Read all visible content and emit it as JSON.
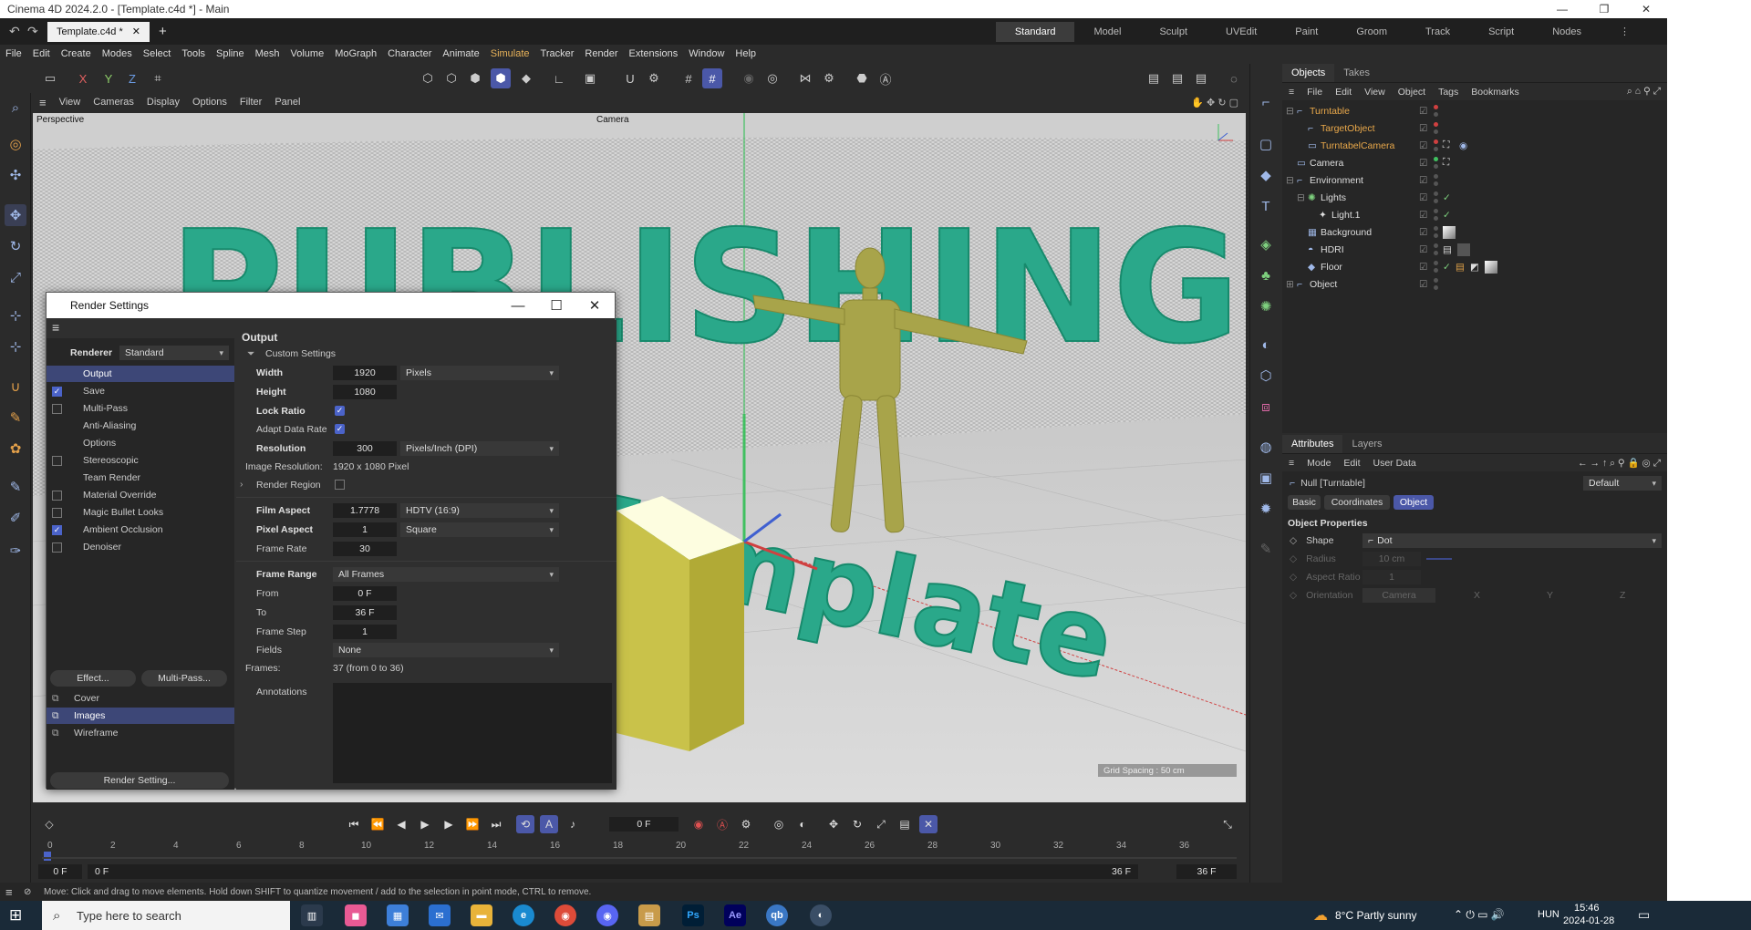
{
  "window": {
    "title": "Cinema 4D 2024.2.0 - [Template.c4d *] - Main",
    "minimize": "—",
    "maximize": "❐",
    "close": "✕"
  },
  "tabs": {
    "document": "Template.c4d *",
    "close": "✕",
    "add": "+"
  },
  "layouts": [
    "Standard",
    "Model",
    "Sculpt",
    "UVEdit",
    "Paint",
    "Groom",
    "Track",
    "Script",
    "Nodes"
  ],
  "menu": [
    "File",
    "Edit",
    "Create",
    "Modes",
    "Select",
    "Tools",
    "Spline",
    "Mesh",
    "Volume",
    "MoGraph",
    "Character",
    "Animate",
    "Simulate",
    "Tracker",
    "Render",
    "Extensions",
    "Window",
    "Help"
  ],
  "axis_buttons": [
    "X",
    "Y",
    "Z"
  ],
  "viewport": {
    "menu": [
      "View",
      "Cameras",
      "Display",
      "Options",
      "Filter",
      "Panel"
    ],
    "label": "Perspective",
    "camera": "Camera",
    "grid_spacing": "Grid Spacing : 50 cm",
    "text_3d_top": "PUBLISHING",
    "text_3d_bottom": "Template"
  },
  "render_settings": {
    "title": "Render Settings",
    "renderer_label": "Renderer",
    "renderer_value": "Standard",
    "items": [
      {
        "label": "Output",
        "check": "none",
        "selected": true
      },
      {
        "label": "Save",
        "check": "on"
      },
      {
        "label": "Multi-Pass",
        "check": "off"
      },
      {
        "label": "Anti-Aliasing",
        "check": "none"
      },
      {
        "label": "Options",
        "check": "none"
      },
      {
        "label": "Stereoscopic",
        "check": "off"
      },
      {
        "label": "Team Render",
        "check": "none"
      },
      {
        "label": "Material Override",
        "check": "off"
      },
      {
        "label": "Magic Bullet Looks",
        "check": "off"
      },
      {
        "label": "Ambient Occlusion",
        "check": "on"
      },
      {
        "label": "Denoiser",
        "check": "off"
      }
    ],
    "effect_button": "Effect...",
    "multipass_button": "Multi-Pass...",
    "presets": [
      {
        "label": "Cover",
        "selected": false
      },
      {
        "label": "Images",
        "selected": true
      },
      {
        "label": "Wireframe",
        "selected": false
      }
    ],
    "render_setting_button": "Render Setting...",
    "output": {
      "heading": "Output",
      "custom": "Custom Settings",
      "width_label": "Width",
      "width_value": "1920",
      "width_unit": "Pixels",
      "height_label": "Height",
      "height_value": "1080",
      "lock_ratio_label": "Lock Ratio",
      "adapt_label": "Adapt Data Rate",
      "resolution_label": "Resolution",
      "resolution_value": "300",
      "resolution_unit": "Pixels/Inch (DPI)",
      "image_res_label": "Image Resolution:",
      "image_res_value": "1920 x 1080 Pixel",
      "render_region_label": "Render Region",
      "film_aspect_label": "Film Aspect",
      "film_aspect_value": "1.7778",
      "film_aspect_preset": "HDTV (16:9)",
      "pixel_aspect_label": "Pixel Aspect",
      "pixel_aspect_value": "1",
      "pixel_aspect_preset": "Square",
      "frame_rate_label": "Frame Rate",
      "frame_rate_value": "30",
      "frame_range_label": "Frame Range",
      "frame_range_value": "All Frames",
      "from_label": "From",
      "from_value": "0 F",
      "to_label": "To",
      "to_value": "36 F",
      "frame_step_label": "Frame Step",
      "frame_step_value": "1",
      "fields_label": "Fields",
      "fields_value": "None",
      "frames_label": "Frames:",
      "frames_value": "37 (from 0 to 36)",
      "annotations_label": "Annotations"
    }
  },
  "objects_panel": {
    "tabs": [
      "Objects",
      "Takes"
    ],
    "menu": [
      "File",
      "Edit",
      "View",
      "Object",
      "Tags",
      "Bookmarks"
    ],
    "rows": [
      {
        "name": "Turntable",
        "color": "#e9a84a",
        "indent": 0
      },
      {
        "name": "TargetObject",
        "color": "#e9a84a",
        "indent": 1
      },
      {
        "name": "TurntabelCamera",
        "color": "#e9a84a",
        "indent": 1
      },
      {
        "name": "Camera",
        "color": "#dddddd",
        "indent": 0
      },
      {
        "name": "Environment",
        "color": "#dddddd",
        "indent": 0
      },
      {
        "name": "Lights",
        "color": "#dddddd",
        "indent": 1
      },
      {
        "name": "Light.1",
        "color": "#dddddd",
        "indent": 2
      },
      {
        "name": "Background",
        "color": "#dddddd",
        "indent": 1
      },
      {
        "name": "HDRI",
        "color": "#dddddd",
        "indent": 1
      },
      {
        "name": "Floor",
        "color": "#dddddd",
        "indent": 1
      },
      {
        "name": "Object",
        "color": "#dddddd",
        "indent": 0
      }
    ]
  },
  "attributes": {
    "tabs": [
      "Attributes",
      "Layers"
    ],
    "menu": [
      "Mode",
      "Edit",
      "User Data"
    ],
    "object_name": "Null [Turntable]",
    "preset": "Default",
    "subtabs": [
      "Basic",
      "Coordinates",
      "Object"
    ],
    "section": "Object Properties",
    "shape_label": "Shape",
    "shape_value": "Dot",
    "radius_label": "Radius",
    "radius_value": "10 cm",
    "aspect_label": "Aspect Ratio",
    "aspect_value": "1",
    "orientation_label": "Orientation",
    "orientation_value": "Camera",
    "axes": [
      "X",
      "Y",
      "Z"
    ]
  },
  "timeline": {
    "current": "0 F",
    "ticks": [
      "0",
      "2",
      "4",
      "6",
      "8",
      "10",
      "12",
      "14",
      "16",
      "18",
      "20",
      "22",
      "24",
      "26",
      "28",
      "30",
      "32",
      "34",
      "36"
    ],
    "start": "0 F",
    "start2": "0 F",
    "end": "36 F",
    "end2": "36 F"
  },
  "status": "Move: Click and drag to move elements. Hold down SHIFT to quantize movement / add to the selection in point mode, CTRL to remove.",
  "taskbar": {
    "search_placeholder": "Type here to search",
    "weather": "8°C  Partly sunny",
    "lang": "HUN",
    "time": "15:46",
    "date": "2024-01-28",
    "apps": [
      "Ps",
      "Ae",
      "qb"
    ]
  }
}
